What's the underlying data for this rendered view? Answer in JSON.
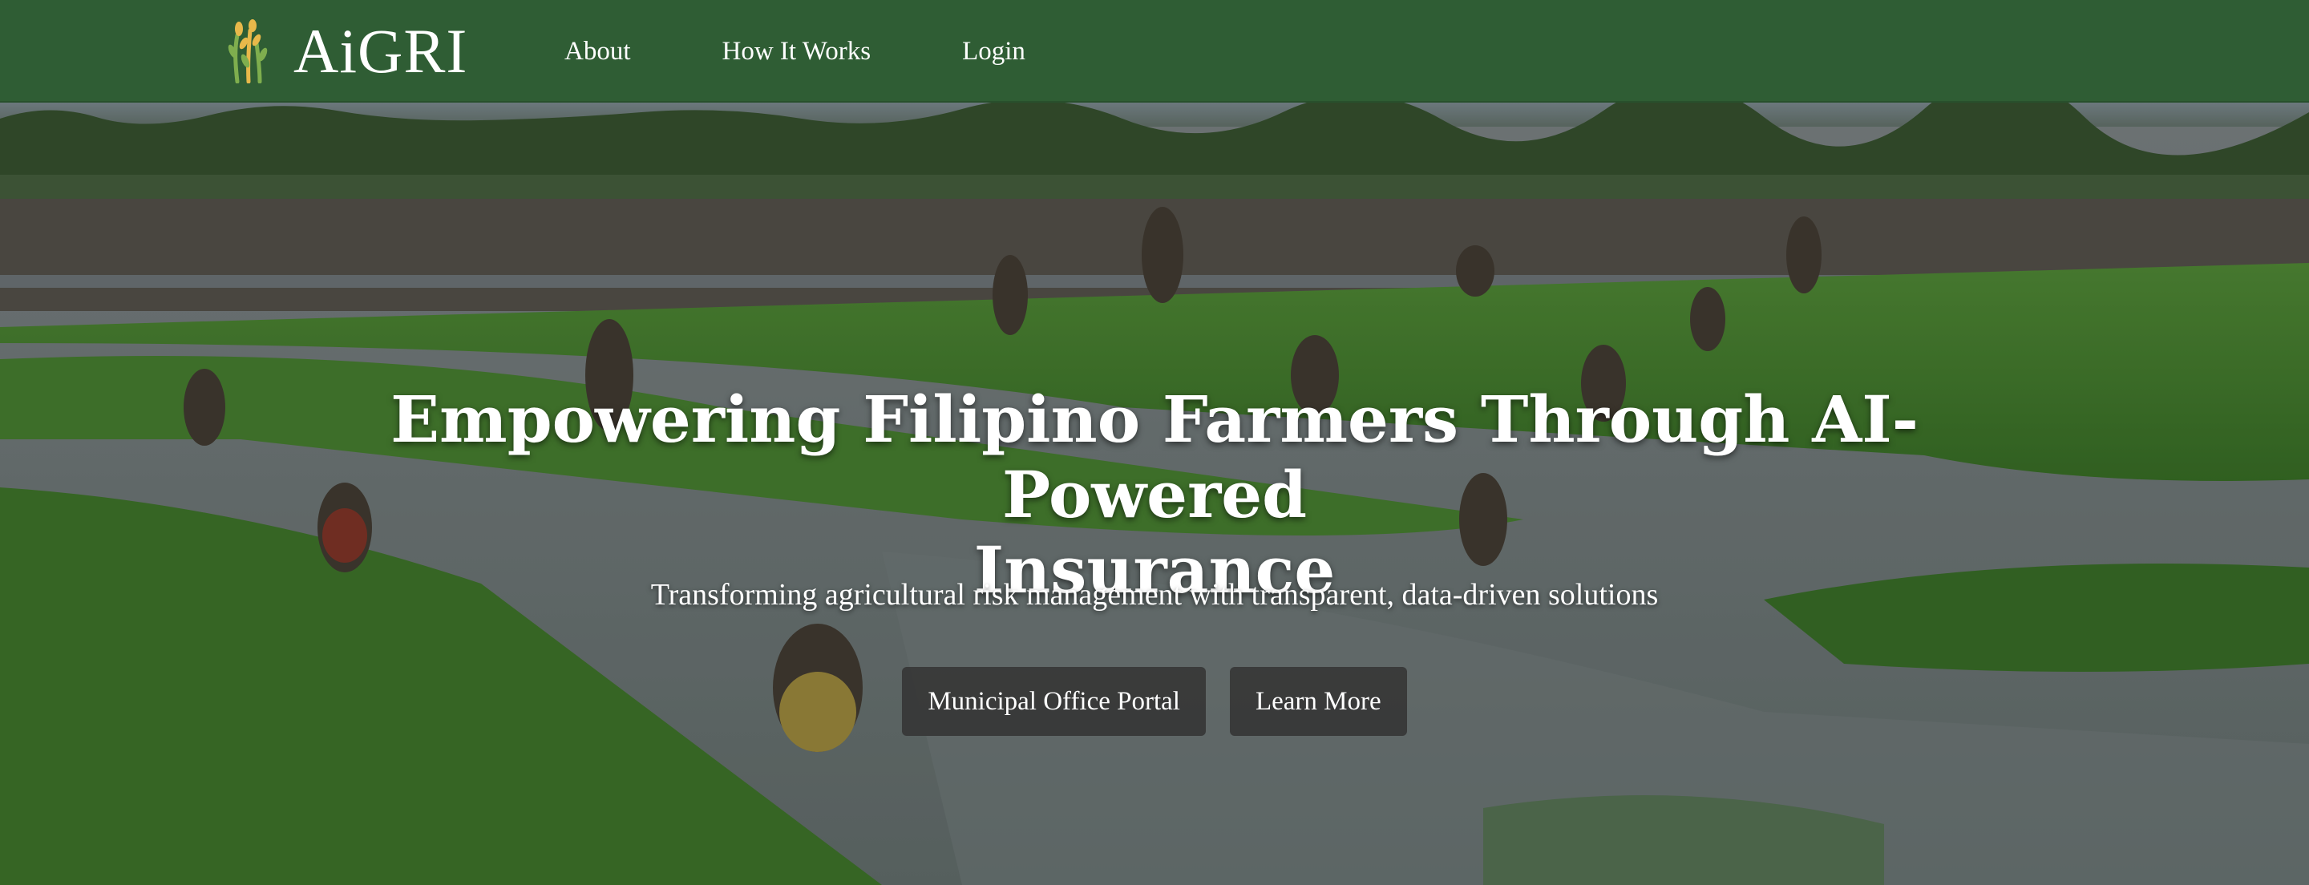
{
  "brand": {
    "name": "AiGRI",
    "logo_icon": "wheat-stalks-icon"
  },
  "nav": {
    "items": [
      "About",
      "How It Works",
      "Login"
    ]
  },
  "hero": {
    "title_line1": "Empowering Filipino Farmers Through AI-Powered",
    "title_line2": "Insurance",
    "subtitle": "Transforming agricultural risk management with transparent, data-driven solutions",
    "buttons": {
      "primary": "Municipal Office Portal",
      "secondary": "Learn More"
    },
    "background_image": "rice-field-farmers-planting"
  },
  "colors": {
    "navbar": "#2f5d34",
    "button_bg": "#343434",
    "text": "#ffffff",
    "logo_gold": "#e8b84a",
    "logo_green": "#7fae4e"
  }
}
